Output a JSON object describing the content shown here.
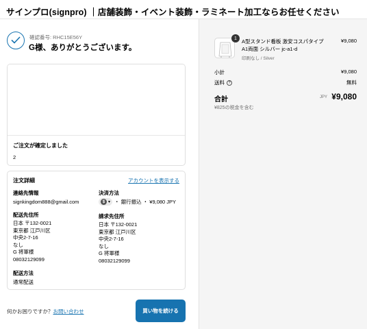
{
  "header": {
    "brand": "サインプロ(signpro) ｜店舗装飾・イベント装飾・ラミネート加工ならお任せください"
  },
  "confirmation": {
    "number_label": "確認番号: RHC15E56Y",
    "thanks": "G様、ありがとうございます。"
  },
  "order_status": {
    "title": "ご注文が確定しました",
    "value": "2"
  },
  "details": {
    "title": "注文詳細",
    "account_link": "アカウントを表示する",
    "contact_label": "連絡先情報",
    "contact_value": "signkingdom888@gmail.com",
    "payment_label": "決済方法",
    "payment_badge": "$",
    "payment_value": "・ 銀行振込 ・ ¥9,080 JPY",
    "shipping_address_label": "配送先住所",
    "shipping_address": [
      "日本 〒132-0021",
      "東京都 江戸川区",
      "中央2-7-16",
      "なし",
      "G 将軍様",
      "08032129099"
    ],
    "billing_address_label": "請求先住所",
    "billing_address": [
      "日本 〒132-0021",
      "東京都 江戸川区",
      "中央2-7-16",
      "なし",
      "G 将軍様",
      "08032129099"
    ],
    "shipping_method_label": "配送方法",
    "shipping_method_value": "通常配送"
  },
  "footer": {
    "help_text": "何かお困りですか？",
    "help_link": "お問い合わせ",
    "continue_button": "買い物を続ける"
  },
  "summary": {
    "item": {
      "quantity": "1",
      "name": "A型スタンド看板 激安コスパタイプ A1両面 シルバー jc-a1-d",
      "variant": "印刷なし / Silver",
      "price": "¥9,080"
    },
    "subtotal_label": "小計",
    "subtotal_value": "¥9,080",
    "shipping_label": "送料",
    "shipping_value": "無料",
    "total_label": "合計",
    "currency": "JPY",
    "total_value": "¥9,080",
    "tax_note": "¥825の税金を含む"
  },
  "colors": {
    "accent": "#1773b0",
    "summary_bg": "#f5f5f5"
  }
}
